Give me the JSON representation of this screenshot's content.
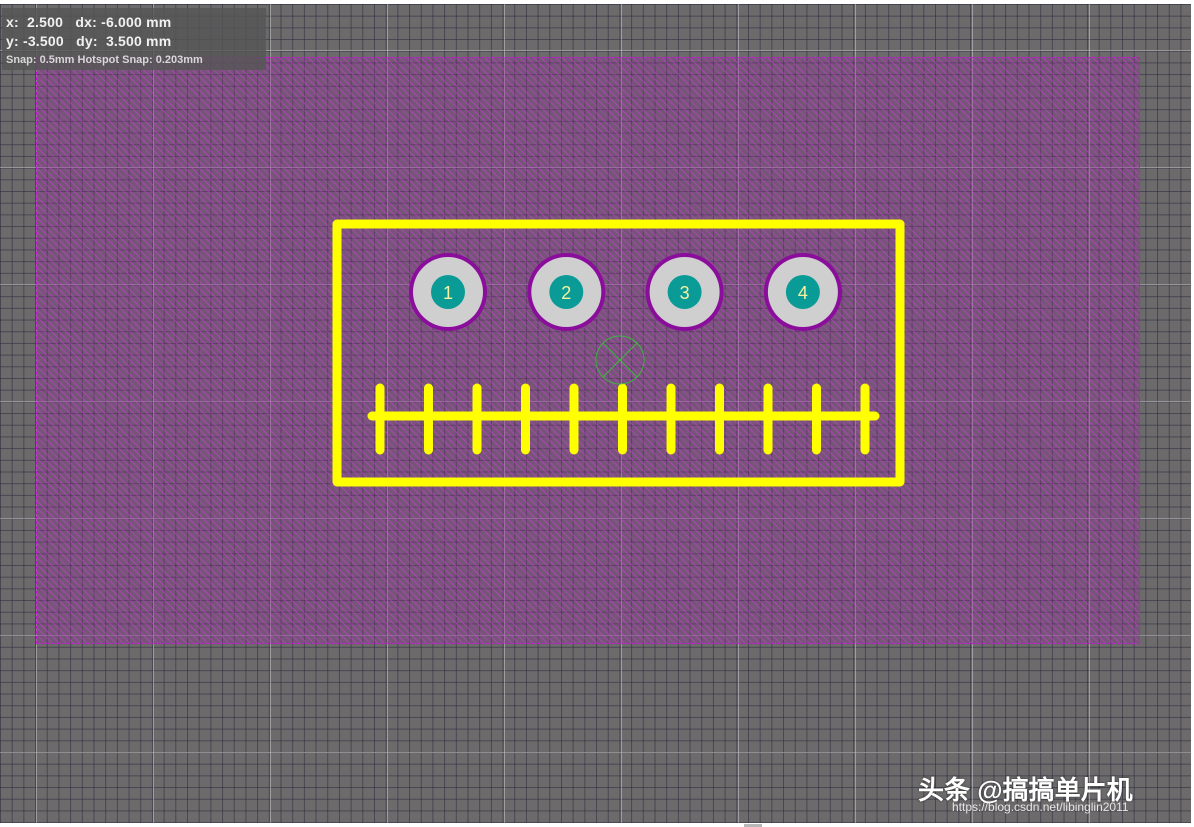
{
  "readout": {
    "x_label": "x:",
    "x_value": "2.500",
    "dx_label": "dx:",
    "dx_value": "-6.000 mm",
    "y_label": "y:",
    "y_value": "-3.500",
    "dy_label": "dy:",
    "dy_value": "3.500 mm",
    "snap": "Snap: 0.5mm Hotspot Snap: 0.203mm"
  },
  "component": {
    "pads": [
      {
        "number": "1"
      },
      {
        "number": "2"
      },
      {
        "number": "3"
      },
      {
        "number": "4"
      }
    ],
    "comb_tick_count": 11
  },
  "colors": {
    "canvas_bg": "#6c6a6b",
    "keepout": "#c21ad3",
    "silkscreen": "#ffff00",
    "pad_ring": "#cfcfcf",
    "pad_mask": "#8a0e9b",
    "pad_hole": "#0a9b96",
    "origin_marker": "#2ed02e"
  },
  "watermark": {
    "text": "头条 @搞搞单片机",
    "url": "https://blog.csdn.net/libinglin2011"
  }
}
